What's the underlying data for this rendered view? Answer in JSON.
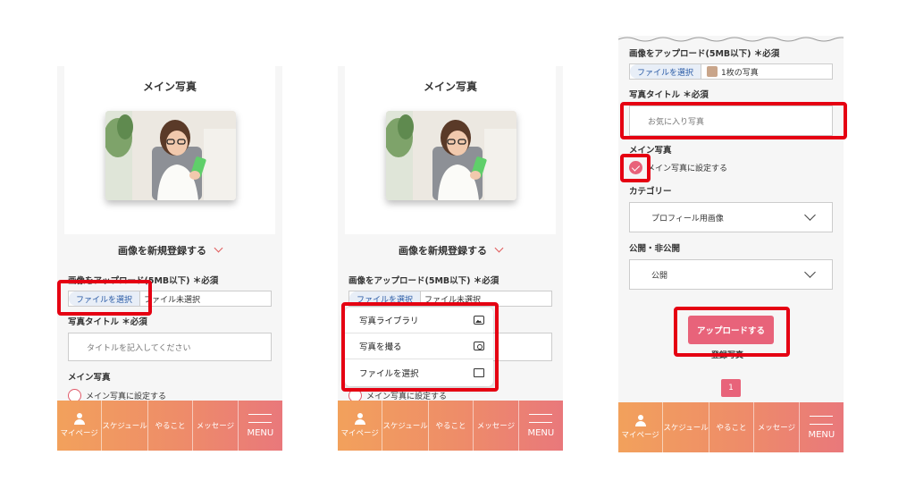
{
  "screen1": {
    "card_title": "メイン写真",
    "register_label": "画像を新規登録する",
    "upload_label": "画像をアップロード(5MB以下) ＊必須",
    "file_button": "ファイルを選択",
    "file_status": "ファイル未選択",
    "title_label": "写真タイトル ＊必須",
    "title_placeholder": "タイトルを記入してください",
    "main_label": "メイン写真",
    "main_radio": "メイン写真に設定する"
  },
  "screen2": {
    "card_title": "メイン写真",
    "register_label": "画像を新規登録する",
    "upload_label": "画像をアップロード(5MB以下) ＊必須",
    "file_button": "ファイルを選択",
    "file_status": "ファイル未選択",
    "main_radio": "メイン写真に設定する",
    "popup": [
      {
        "label": "写真ライブラリ",
        "icon": "photo-library-icon"
      },
      {
        "label": "写真を撮る",
        "icon": "camera-icon"
      },
      {
        "label": "ファイルを選択",
        "icon": "folder-icon"
      }
    ]
  },
  "screen3": {
    "upload_label": "画像をアップロード(5MB以下) ＊必須",
    "file_button": "ファイルを選択",
    "file_status": "1枚の写真",
    "title_label": "写真タイトル ＊必須",
    "title_value": "お気に入り写真",
    "main_label": "メイン写真",
    "main_check": "メイン写真に設定する",
    "category_label": "カテゴリー",
    "category_value": "プロフィール用画像",
    "visibility_label": "公開・非公開",
    "visibility_value": "公開",
    "upload_button": "アップロードする",
    "registered_label": "登録写真",
    "page": "1"
  },
  "nav": {
    "mypage": "マイページ",
    "schedule": "スケジュール",
    "todo": "やること",
    "message": "メッセージ",
    "menu": "MENU"
  },
  "colors": {
    "accent": "#e8637a",
    "highlight": "#e50012",
    "nav_start": "#f2a15c",
    "nav_end": "#e9787b"
  }
}
